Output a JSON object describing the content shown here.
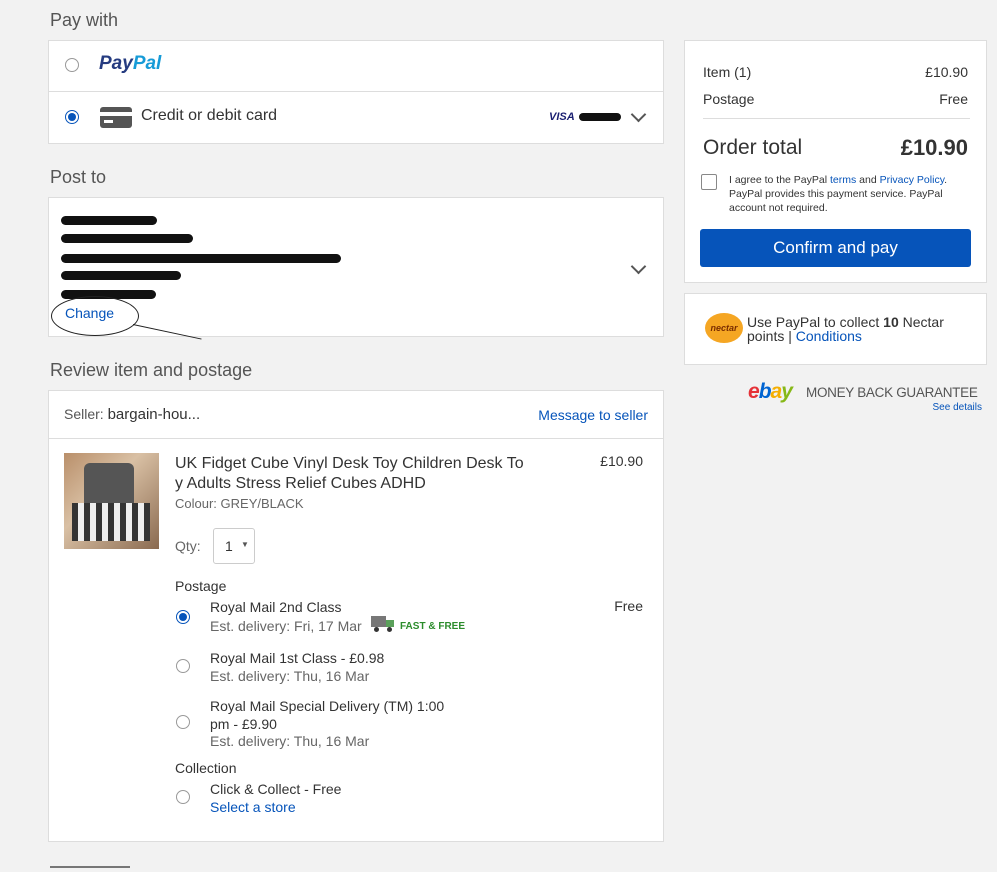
{
  "pay_with": {
    "title": "Pay with",
    "paypal_label": "PayPal",
    "card_label": "Credit or debit card",
    "card_brand": "VISA"
  },
  "post_to": {
    "title": "Post to",
    "change_link": "Change"
  },
  "review": {
    "title": "Review item and postage",
    "seller_label": "Seller:",
    "seller_name": "bargain-hou...",
    "message_link": "Message to seller",
    "item": {
      "title_line1": "UK Fidget Cube Vinyl Desk Toy Children Desk To",
      "title_line2": "y Adults Stress Relief Cubes ADHD",
      "colour": "Colour: GREY/BLACK",
      "price": "£10.90",
      "qty_label": "Qty:",
      "qty_value": "1"
    },
    "postage": {
      "label": "Postage",
      "options": [
        {
          "name": "Royal Mail 2nd Class",
          "delivery": "Est. delivery: Fri, 17 Mar",
          "badge": "FAST & FREE",
          "price": "Free",
          "selected": true
        },
        {
          "name": "Royal Mail 1st Class - £0.98",
          "delivery": "Est. delivery: Thu, 16 Mar",
          "selected": false
        },
        {
          "name_line1": "Royal Mail Special Delivery (TM) 1:00",
          "name_line2": "pm - £9.90",
          "delivery": "Est. delivery: Thu, 16 Mar",
          "selected": false
        }
      ]
    },
    "collection": {
      "label": "Collection",
      "option": "Click & Collect - Free",
      "select_link": "Select a store"
    }
  },
  "summary": {
    "item_label": "Item (1)",
    "item_value": "£10.90",
    "postage_label": "Postage",
    "postage_value": "Free",
    "total_label": "Order total",
    "total_value": "£10.90",
    "agree_prefix": "I agree to the PayPal ",
    "agree_terms": "terms",
    "agree_and": " and ",
    "agree_privacy": "Privacy Policy",
    "agree_rest": ". PayPal provides this payment service. PayPal account not required.",
    "confirm_button": "Confirm and pay"
  },
  "nectar": {
    "logo": "nectar",
    "text_prefix": "Use PayPal to collect ",
    "points": "10",
    "text_suffix": " Nectar",
    "text_line2": "points | ",
    "conditions_link": "Conditions"
  },
  "guarantee": {
    "ebay_e": "e",
    "ebay_b": "b",
    "ebay_a": "a",
    "ebay_y": "y",
    "text": "MONEY BACK GUARANTEE",
    "details_link": "See details"
  },
  "colors": {
    "primary": "#0654ba",
    "confirm_bg": "#0654ba",
    "fast_free": "#2c8c2c"
  }
}
